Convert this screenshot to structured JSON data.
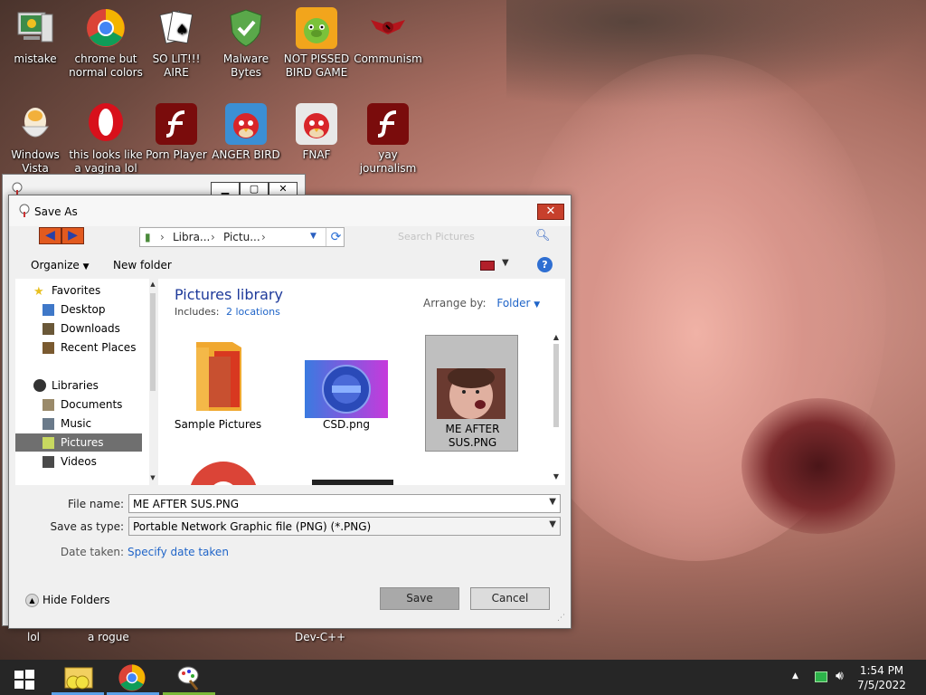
{
  "desktop": {
    "icons": [
      {
        "label": "mistake",
        "icon": "computer-icon"
      },
      {
        "label": "chrome but normal colors",
        "icon": "chrome-icon"
      },
      {
        "label": "SO LIT!!! AIRE",
        "icon": "cards-icon"
      },
      {
        "label": "Malware Bytes",
        "icon": "shield-icon"
      },
      {
        "label": "NOT PISSED BIRD GAME",
        "icon": "green-pig-icon"
      },
      {
        "label": "Communism",
        "icon": "emblem-icon"
      },
      {
        "label": "Windows Vista",
        "icon": "egg-icon"
      },
      {
        "label": "this looks like a vagina lol",
        "icon": "opera-icon"
      },
      {
        "label": "Porn Player",
        "icon": "flash-icon"
      },
      {
        "label": "ANGER BIRD",
        "icon": "angry-bird-icon"
      },
      {
        "label": "FNAF",
        "icon": "angry-bird-icon"
      },
      {
        "label": "yay journalism",
        "icon": "flash-icon"
      }
    ],
    "partial_labels": [
      "lol",
      "a rogue",
      "Dev-C++"
    ]
  },
  "dialog": {
    "title": "Save As",
    "close_label": "✕",
    "address": {
      "segments": [
        "Libra...",
        "Pictu..."
      ]
    },
    "search_placeholder": "Search Pictures",
    "toolbar": {
      "organize": "Organize",
      "new_folder": "New folder",
      "help": "?"
    },
    "nav": {
      "favorites_header": "Favorites",
      "favorites": [
        "Desktop",
        "Downloads",
        "Recent Places"
      ],
      "libraries_header": "Libraries",
      "libraries": [
        "Documents",
        "Music",
        "Pictures",
        "Videos"
      ],
      "selected": "Pictures"
    },
    "content": {
      "library_title": "Pictures library",
      "includes_label": "Includes:",
      "includes_link": "2 locations",
      "arrange_label": "Arrange by:",
      "arrange_value": "Folder",
      "tiles": [
        {
          "caption": "Sample Pictures",
          "kind": "folder"
        },
        {
          "caption": "CSD.png",
          "kind": "image"
        },
        {
          "caption": "ME AFTER SUS.PNG",
          "kind": "image",
          "selected": true
        }
      ]
    },
    "form": {
      "file_name_label": "File name:",
      "file_name_value": "ME AFTER SUS.PNG",
      "type_label": "Save as type:",
      "type_value": "Portable Network Graphic file (PNG) (*.PNG)",
      "date_label": "Date taken:",
      "date_link": "Specify date taken"
    },
    "hide_folders": "Hide Folders",
    "save_label": "Save",
    "cancel_label": "Cancel"
  },
  "taskbar": {
    "clock_time": "1:54 PM",
    "clock_date": "7/5/2022",
    "colors": {
      "bar": "#262626",
      "underline": "#5aa0e8"
    }
  }
}
